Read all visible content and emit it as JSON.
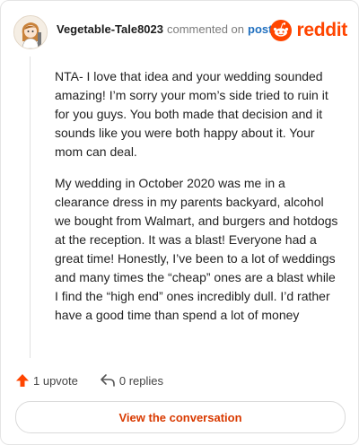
{
  "header": {
    "username": "Vegetable-Tale8023",
    "action_text": "commented on",
    "post_link": "post",
    "brand": "reddit"
  },
  "comment": {
    "paragraphs": [
      "NTA- I love that idea and your wedding sounded amazing! I’m sorry your mom’s side tried to ruin it for you guys. You both made that decision and it sounds like you were both happy about it. Your mom can deal.",
      "My wedding in October 2020 was me in a clearance dress in my parents backyard, alcohol we bought from Walmart, and burgers and hotdogs at the reception. It was a blast! Everyone had a great time! Honestly, I’ve been to a lot of weddings and many times the “cheap” ones are a blast while I find the “high end” ones incredibly dull. I’d rather have a good time than spend a lot of money"
    ]
  },
  "actions": {
    "upvote_label": "1 upvote",
    "replies_label": "0 replies"
  },
  "cta": {
    "label": "View the conversation"
  },
  "colors": {
    "brand": "#ff4500",
    "upvote": "#ff4500",
    "cta_text": "#d93a00",
    "link": "#1f6fbf"
  },
  "icons": {
    "upvote": "upvote-arrow-icon",
    "reply": "reply-arrow-icon",
    "brand": "reddit-snoo-icon"
  }
}
